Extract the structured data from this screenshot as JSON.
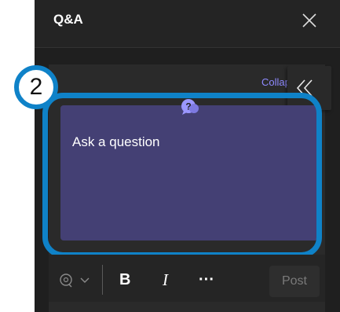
{
  "panel": {
    "title": "Q&A",
    "close_icon": "close-icon"
  },
  "content": {
    "collapse_label": "Collapse",
    "collapse_icon": "double-chevron-left-icon",
    "qa_icon": "question-bubble-icon",
    "question_placeholder": "Ask a question"
  },
  "annotation": {
    "step_number": "2",
    "highlight_color": "#0f82c8"
  },
  "toolbar": {
    "mention_icon": "mention-icon",
    "dropdown_icon": "chevron-down-icon",
    "bold_label": "B",
    "italic_label": "I",
    "more_label": "···",
    "post_label": "Post"
  },
  "colors": {
    "panel_bg": "#1f1f1f",
    "question_bg": "#444074",
    "accent": "#8f8aff"
  }
}
